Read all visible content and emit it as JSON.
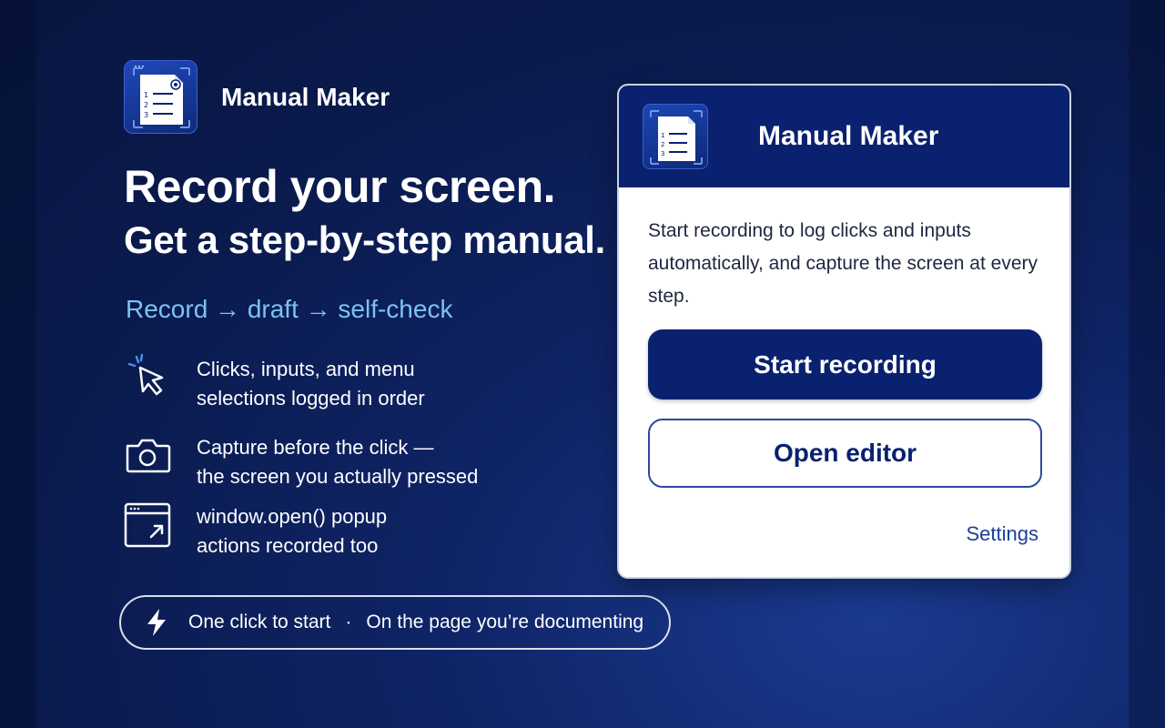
{
  "brand": {
    "name": "Manual Maker"
  },
  "headline": {
    "line1": "Record your screen.",
    "line2": "Get a step-by-step manual."
  },
  "flow": "Record → draft → self-check",
  "features": [
    {
      "icon": "cursor-click-icon",
      "line1": "Clicks, inputs, and menu",
      "line2": "selections logged in order"
    },
    {
      "icon": "camera-icon",
      "line1": "Capture before the click —",
      "line2": "the screen you actually pressed"
    },
    {
      "icon": "popup-window-icon",
      "line1": "window.open() popup",
      "line2": "actions recorded too"
    }
  ],
  "pill": {
    "part1": "One click to start",
    "separator": "·",
    "part2": "On the page you’re documenting"
  },
  "popup": {
    "title": "Manual Maker",
    "description": "Start recording to log clicks and inputs automatically, and capture the screen at every step.",
    "primary_button": "Start recording",
    "secondary_button": "Open editor",
    "settings_link": "Settings"
  },
  "colors": {
    "navy": "#0a2170",
    "accent_light_blue": "#7cc2f2",
    "background": "#0b1a4a"
  }
}
